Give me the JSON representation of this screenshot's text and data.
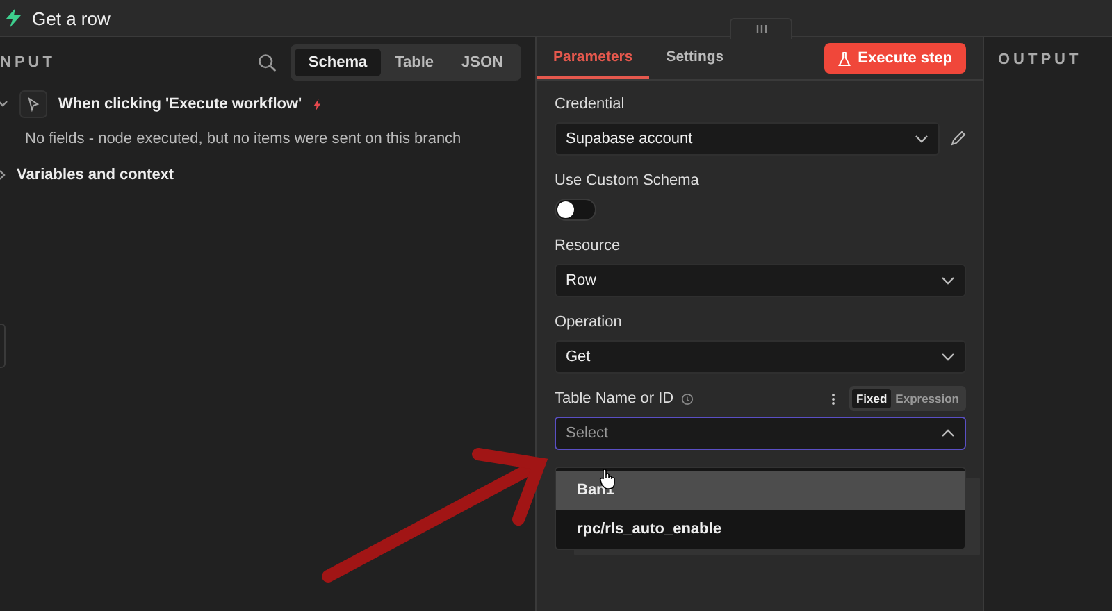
{
  "header": {
    "title": "Get a row"
  },
  "input_panel": {
    "title": "NPUT",
    "view_tabs": [
      {
        "label": "Schema",
        "selected": true
      },
      {
        "label": "Table",
        "selected": false
      },
      {
        "label": "JSON",
        "selected": false
      }
    ],
    "tree": [
      {
        "label": "When clicking 'Execute workflow'",
        "expanded": true,
        "message": "No fields - node executed, but no items were sent on this branch"
      },
      {
        "label": "Variables and context",
        "expanded": false
      }
    ]
  },
  "parameters_panel": {
    "tabs": [
      {
        "label": "Parameters",
        "selected": true
      },
      {
        "label": "Settings",
        "selected": false
      }
    ],
    "execute_button": "Execute step",
    "fields": [
      {
        "kind": "select",
        "label": "Credential",
        "value": "Supabase account",
        "editable": true
      },
      {
        "kind": "toggle",
        "label": "Use Custom Schema",
        "on": false
      },
      {
        "kind": "select",
        "label": "Resource",
        "value": "Row"
      },
      {
        "kind": "select",
        "label": "Operation",
        "value": "Get"
      },
      {
        "kind": "select",
        "label": "Table Name or ID",
        "placeholder": "Select",
        "help": true,
        "open": true,
        "modes": [
          {
            "label": "Fixed",
            "selected": true
          },
          {
            "label": "Expression",
            "selected": false
          }
        ],
        "options": [
          {
            "label": "Ban1",
            "selected": true
          },
          {
            "label": "rpc/rls_auto_enable",
            "selected": false
          }
        ]
      }
    ]
  },
  "output_panel": {
    "title": "OUTPUT"
  }
}
